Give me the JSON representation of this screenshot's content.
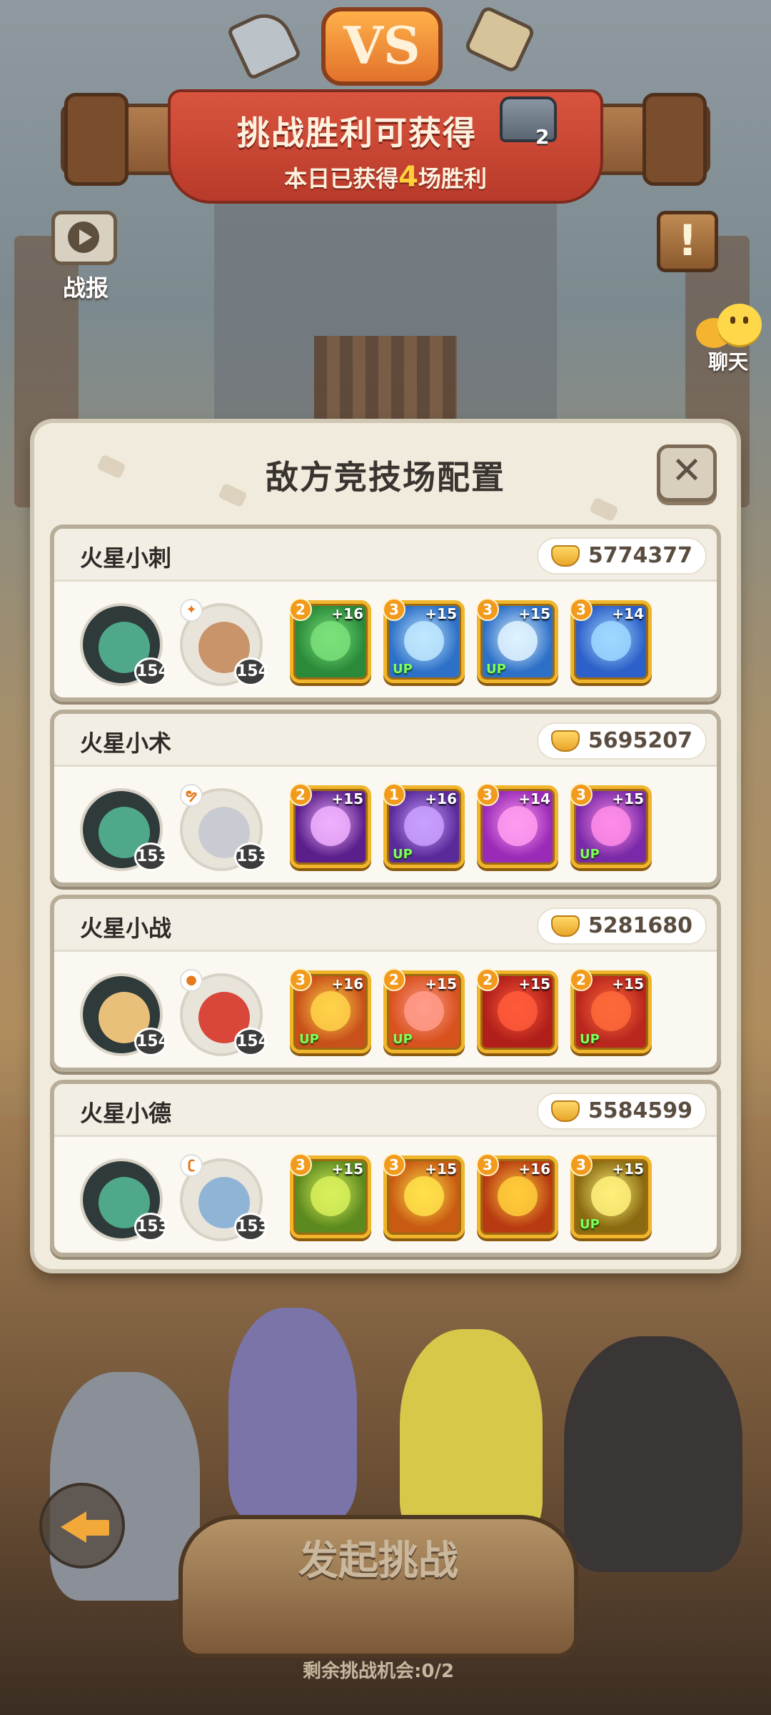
{
  "banner": {
    "title": "挑战胜利可获得",
    "subtitle_prefix": "本日已获得",
    "wins_today": "4",
    "subtitle_suffix": "场胜利",
    "chest_count": "2",
    "vs_text": "VS"
  },
  "side_buttons": {
    "battle_report_label": "战报",
    "chat_label": "聊天",
    "notice_glyph": "!"
  },
  "modal": {
    "title": "敌方竞技场配置",
    "close_glyph": "✕",
    "opponents": [
      {
        "name": "火星小刺",
        "power": "5774377",
        "pet": {
          "level": "154",
          "icon": "wolf-pet-icon",
          "color": "#4fa88a"
        },
        "hero": {
          "level": "154",
          "icon": "headband-hero-icon",
          "color": "#c9946a",
          "element": "✦"
        },
        "skills": [
          {
            "grade": "2",
            "plus": "+16",
            "up": false,
            "color": "#2a8a3a",
            "accent": "#7be07a"
          },
          {
            "grade": "3",
            "plus": "+15",
            "up": true,
            "color": "#2d70c8",
            "accent": "#bfe7ff"
          },
          {
            "grade": "3",
            "plus": "+15",
            "up": true,
            "color": "#2d70c8",
            "accent": "#dff3ff"
          },
          {
            "grade": "3",
            "plus": "+14",
            "up": false,
            "color": "#2d60c8",
            "accent": "#9fd8ff"
          }
        ]
      },
      {
        "name": "火星小术",
        "power": "5695207",
        "pet": {
          "level": "153",
          "icon": "wolf-pet-icon",
          "color": "#4fa88a"
        },
        "hero": {
          "level": "153",
          "icon": "silver-hair-hero-icon",
          "color": "#c8ccd2",
          "element": "ຯ"
        },
        "skills": [
          {
            "grade": "2",
            "plus": "+15",
            "up": false,
            "color": "#5a1f8a",
            "accent": "#f0b0ff"
          },
          {
            "grade": "1",
            "plus": "+16",
            "up": true,
            "color": "#5a2a9a",
            "accent": "#c9a0ff"
          },
          {
            "grade": "3",
            "plus": "+14",
            "up": false,
            "color": "#9a2ab8",
            "accent": "#ff9cf0"
          },
          {
            "grade": "3",
            "plus": "+15",
            "up": true,
            "color": "#7a2aa8",
            "accent": "#ff8ce8"
          }
        ]
      },
      {
        "name": "火星小战",
        "power": "5281680",
        "pet": {
          "level": "154",
          "icon": "cat-pet-icon",
          "color": "#e8c07a"
        },
        "hero": {
          "level": "154",
          "icon": "red-hair-hero-icon",
          "color": "#d9463a",
          "element": "●"
        },
        "skills": [
          {
            "grade": "3",
            "plus": "+16",
            "up": true,
            "color": "#c8501a",
            "accent": "#ffd24a"
          },
          {
            "grade": "2",
            "plus": "+15",
            "up": true,
            "color": "#d8521e",
            "accent": "#ff9b8a"
          },
          {
            "grade": "2",
            "plus": "+15",
            "up": false,
            "color": "#b01f1a",
            "accent": "#ff5a3a"
          },
          {
            "grade": "2",
            "plus": "+15",
            "up": true,
            "color": "#b8261e",
            "accent": "#ff6a3a"
          }
        ]
      },
      {
        "name": "火星小德",
        "power": "5584599",
        "pet": {
          "level": "153",
          "icon": "wolf-pet-icon",
          "color": "#4fa88a"
        },
        "hero": {
          "level": "153",
          "icon": "blue-hair-hero-icon",
          "color": "#8fb4d6",
          "element": "ʗ"
        },
        "skills": [
          {
            "grade": "3",
            "plus": "+15",
            "up": false,
            "color": "#5d8a1e",
            "accent": "#d8f05a"
          },
          {
            "grade": "3",
            "plus": "+15",
            "up": false,
            "color": "#c85a12",
            "accent": "#ffe04a"
          },
          {
            "grade": "3",
            "plus": "+16",
            "up": false,
            "color": "#b83a12",
            "accent": "#ffcc3a"
          },
          {
            "grade": "3",
            "plus": "+15",
            "up": true,
            "color": "#8a6a10",
            "accent": "#fff07a"
          }
        ]
      }
    ]
  },
  "bottom": {
    "challenge_label": "发起挑战",
    "remaining_label": "剩余挑战机会:0/2"
  }
}
